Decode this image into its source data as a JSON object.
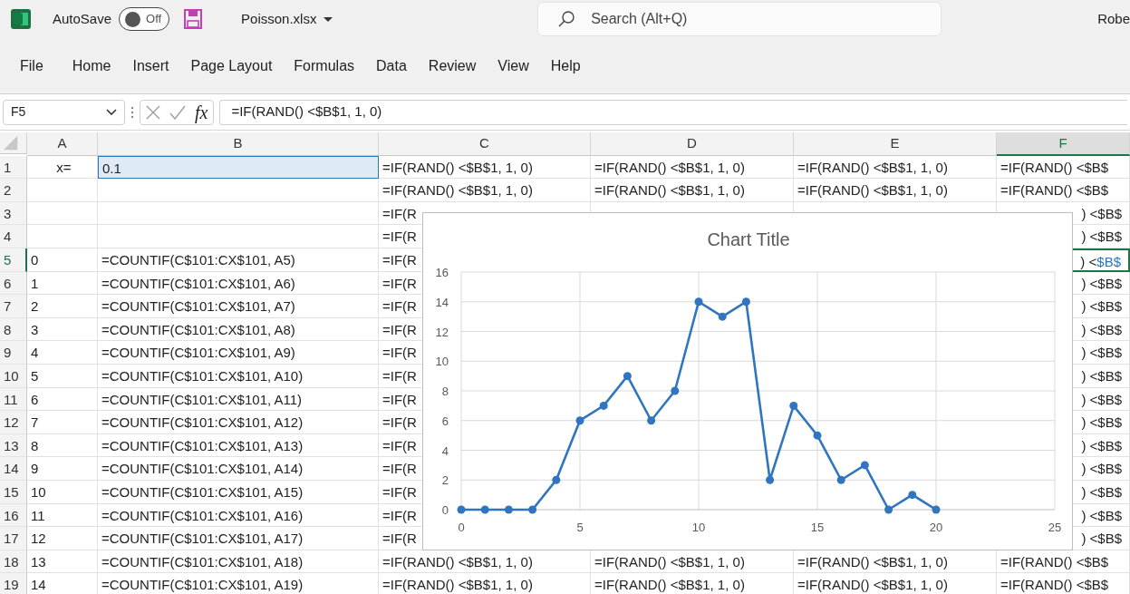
{
  "title_bar": {
    "autosave_label": "AutoSave",
    "autosave_on": false,
    "toggle_text": "Off",
    "file_name": "Poisson.xlsx",
    "search": {
      "placeholder": "Search (Alt+Q)"
    },
    "user": "Robe"
  },
  "menu": [
    {
      "label": "File",
      "selected": false
    },
    {
      "label": "Home",
      "selected": false
    },
    {
      "label": "Insert",
      "selected": false
    },
    {
      "label": "Page Layout",
      "selected": false
    },
    {
      "label": "Formulas",
      "selected": false
    },
    {
      "label": "Data",
      "selected": false
    },
    {
      "label": "Review",
      "selected": false
    },
    {
      "label": "View",
      "selected": false
    },
    {
      "label": "Help",
      "selected": false
    }
  ],
  "formula_bar": {
    "name_box": "F5",
    "function_label": "fx",
    "formula": "=IF(RAND() <$B$1, 1, 0)"
  },
  "columns": [
    {
      "label": "A",
      "selected": false
    },
    {
      "label": "B",
      "selected": false
    },
    {
      "label": "C",
      "selected": false
    },
    {
      "label": "D",
      "selected": false
    },
    {
      "label": "E",
      "selected": false
    },
    {
      "label": "F",
      "selected": true
    }
  ],
  "rows": [
    {
      "number": "1",
      "selected": false,
      "cells": [
        {
          "kind": "label",
          "text": "x="
        },
        {
          "kind": "reference",
          "text": "0.1"
        },
        {
          "kind": "text",
          "text": "=IF(RAND() <$B$1, 1, 0)"
        },
        {
          "kind": "text",
          "text": "=IF(RAND() <$B$1, 1, 0)"
        },
        {
          "kind": "text",
          "text": "=IF(RAND() <$B$1, 1, 0)"
        },
        {
          "kind": "text",
          "text": "=IF(RAND() <$B$"
        }
      ]
    },
    {
      "number": "2",
      "selected": false,
      "cells": [
        {
          "kind": "empty"
        },
        {
          "kind": "empty"
        },
        {
          "kind": "text",
          "text": "=IF(RAND() <$B$1, 1, 0)"
        },
        {
          "kind": "text",
          "text": "=IF(RAND() <$B$1, 1, 0)"
        },
        {
          "kind": "text",
          "text": "=IF(RAND() <$B$1, 1, 0)"
        },
        {
          "kind": "text",
          "text": "=IF(RAND() <$B$"
        }
      ]
    },
    {
      "number": "3",
      "selected": false,
      "cells": [
        {
          "kind": "empty"
        },
        {
          "kind": "empty"
        },
        {
          "kind": "text",
          "text": "=IF(R"
        },
        {
          "kind": "empty"
        },
        {
          "kind": "empty"
        },
        {
          "kind": "tail",
          "text": ") <$B$"
        }
      ]
    },
    {
      "number": "4",
      "selected": false,
      "cells": [
        {
          "kind": "empty"
        },
        {
          "kind": "empty"
        },
        {
          "kind": "text",
          "text": "=IF(R"
        },
        {
          "kind": "covered"
        },
        {
          "kind": "covered"
        },
        {
          "kind": "tail",
          "text": ") <$B$"
        }
      ]
    },
    {
      "number": "5",
      "selected": true,
      "cells": [
        {
          "kind": "text",
          "text": "0"
        },
        {
          "kind": "text",
          "text": "=COUNTIF(C$101:CX$101, A5)"
        },
        {
          "kind": "text",
          "text": "=IF(R"
        },
        {
          "kind": "covered"
        },
        {
          "kind": "covered"
        },
        {
          "kind": "active",
          "text": ") <",
          "ref": "$B$"
        }
      ]
    },
    {
      "number": "6",
      "selected": false,
      "cells": [
        {
          "kind": "text",
          "text": "1"
        },
        {
          "kind": "text",
          "text": "=COUNTIF(C$101:CX$101, A6)"
        },
        {
          "kind": "text",
          "text": "=IF(R"
        },
        {
          "kind": "covered"
        },
        {
          "kind": "covered"
        },
        {
          "kind": "tail",
          "text": ") <$B$"
        }
      ]
    },
    {
      "number": "7",
      "selected": false,
      "cells": [
        {
          "kind": "text",
          "text": "2"
        },
        {
          "kind": "text",
          "text": "=COUNTIF(C$101:CX$101, A7)"
        },
        {
          "kind": "text",
          "text": "=IF(R"
        },
        {
          "kind": "covered"
        },
        {
          "kind": "covered"
        },
        {
          "kind": "tail",
          "text": ") <$B$"
        }
      ]
    },
    {
      "number": "8",
      "selected": false,
      "cells": [
        {
          "kind": "text",
          "text": "3"
        },
        {
          "kind": "text",
          "text": "=COUNTIF(C$101:CX$101, A8)"
        },
        {
          "kind": "text",
          "text": "=IF(R"
        },
        {
          "kind": "covered"
        },
        {
          "kind": "covered"
        },
        {
          "kind": "tail",
          "text": ") <$B$"
        }
      ]
    },
    {
      "number": "9",
      "selected": false,
      "cells": [
        {
          "kind": "text",
          "text": "4"
        },
        {
          "kind": "text",
          "text": "=COUNTIF(C$101:CX$101, A9)"
        },
        {
          "kind": "text",
          "text": "=IF(R"
        },
        {
          "kind": "covered"
        },
        {
          "kind": "covered"
        },
        {
          "kind": "tail",
          "text": ") <$B$"
        }
      ]
    },
    {
      "number": "10",
      "selected": false,
      "cells": [
        {
          "kind": "text",
          "text": "5"
        },
        {
          "kind": "text",
          "text": "=COUNTIF(C$101:CX$101, A10)"
        },
        {
          "kind": "text",
          "text": "=IF(R"
        },
        {
          "kind": "covered"
        },
        {
          "kind": "covered"
        },
        {
          "kind": "tail",
          "text": ") <$B$"
        }
      ]
    },
    {
      "number": "11",
      "selected": false,
      "cells": [
        {
          "kind": "text",
          "text": "6"
        },
        {
          "kind": "text",
          "text": "=COUNTIF(C$101:CX$101, A11)"
        },
        {
          "kind": "text",
          "text": "=IF(R"
        },
        {
          "kind": "covered"
        },
        {
          "kind": "covered"
        },
        {
          "kind": "tail",
          "text": ") <$B$"
        }
      ]
    },
    {
      "number": "12",
      "selected": false,
      "cells": [
        {
          "kind": "text",
          "text": "7"
        },
        {
          "kind": "text",
          "text": "=COUNTIF(C$101:CX$101, A12)"
        },
        {
          "kind": "text",
          "text": "=IF(R"
        },
        {
          "kind": "covered"
        },
        {
          "kind": "covered"
        },
        {
          "kind": "tail",
          "text": ") <$B$"
        }
      ]
    },
    {
      "number": "13",
      "selected": false,
      "cells": [
        {
          "kind": "text",
          "text": "8"
        },
        {
          "kind": "text",
          "text": "=COUNTIF(C$101:CX$101, A13)"
        },
        {
          "kind": "text",
          "text": "=IF(R"
        },
        {
          "kind": "covered"
        },
        {
          "kind": "covered"
        },
        {
          "kind": "tail",
          "text": ") <$B$"
        }
      ]
    },
    {
      "number": "14",
      "selected": false,
      "cells": [
        {
          "kind": "text",
          "text": "9"
        },
        {
          "kind": "text",
          "text": "=COUNTIF(C$101:CX$101, A14)"
        },
        {
          "kind": "text",
          "text": "=IF(R"
        },
        {
          "kind": "covered"
        },
        {
          "kind": "covered"
        },
        {
          "kind": "tail",
          "text": ") <$B$"
        }
      ]
    },
    {
      "number": "15",
      "selected": false,
      "cells": [
        {
          "kind": "text",
          "text": "10"
        },
        {
          "kind": "text",
          "text": "=COUNTIF(C$101:CX$101, A15)"
        },
        {
          "kind": "text",
          "text": "=IF(R"
        },
        {
          "kind": "covered"
        },
        {
          "kind": "covered"
        },
        {
          "kind": "tail",
          "text": ") <$B$"
        }
      ]
    },
    {
      "number": "16",
      "selected": false,
      "cells": [
        {
          "kind": "text",
          "text": "11"
        },
        {
          "kind": "text",
          "text": "=COUNTIF(C$101:CX$101, A16)"
        },
        {
          "kind": "text",
          "text": "=IF(R"
        },
        {
          "kind": "covered"
        },
        {
          "kind": "covered"
        },
        {
          "kind": "tail",
          "text": ") <$B$"
        }
      ]
    },
    {
      "number": "17",
      "selected": false,
      "cells": [
        {
          "kind": "text",
          "text": "12"
        },
        {
          "kind": "text",
          "text": "=COUNTIF(C$101:CX$101, A17)"
        },
        {
          "kind": "text",
          "text": "=IF(R"
        },
        {
          "kind": "covered"
        },
        {
          "kind": "covered"
        },
        {
          "kind": "tail",
          "text": ") <$B$"
        }
      ]
    },
    {
      "number": "18",
      "selected": false,
      "cells": [
        {
          "kind": "text",
          "text": "13"
        },
        {
          "kind": "text",
          "text": "=COUNTIF(C$101:CX$101, A18)"
        },
        {
          "kind": "text",
          "text": "=IF(RAND() <$B$1, 1, 0)"
        },
        {
          "kind": "text",
          "text": "=IF(RAND() <$B$1, 1, 0)"
        },
        {
          "kind": "text",
          "text": "=IF(RAND() <$B$1, 1, 0)"
        },
        {
          "kind": "text",
          "text": "=IF(RAND() <$B$"
        }
      ]
    },
    {
      "number": "19",
      "selected": false,
      "cells": [
        {
          "kind": "text",
          "text": "14"
        },
        {
          "kind": "text",
          "text": "=COUNTIF(C$101:CX$101, A19)"
        },
        {
          "kind": "text",
          "text": "=IF(RAND() <$B$1, 1, 0)"
        },
        {
          "kind": "text",
          "text": "=IF(RAND() <$B$1, 1, 0)"
        },
        {
          "kind": "text",
          "text": "=IF(RAND() <$B$1, 1, 0)"
        },
        {
          "kind": "text",
          "text": "=IF(RAND() <$B$"
        }
      ]
    }
  ],
  "chart": {
    "chart_data": {
      "type": "line",
      "title": "Chart Title",
      "x": [
        0,
        1,
        2,
        3,
        4,
        5,
        6,
        7,
        8,
        9,
        10,
        11,
        12,
        13,
        14,
        15,
        16,
        17,
        18,
        19,
        20
      ],
      "grid": true,
      "series": [
        {
          "color": "#2f75c0",
          "marker": "circle",
          "values": [
            0,
            0,
            0,
            0,
            2,
            6,
            7,
            9,
            6,
            8,
            14,
            13,
            14,
            2,
            7,
            5,
            2,
            3,
            0,
            1,
            0
          ]
        }
      ],
      "xlim": [
        0,
        25
      ],
      "ylim": [
        0,
        16
      ],
      "xticks": [
        0,
        5,
        10,
        15,
        20,
        25
      ],
      "yticks": [
        0,
        2,
        4,
        6,
        8,
        10,
        12,
        14,
        16
      ]
    }
  }
}
